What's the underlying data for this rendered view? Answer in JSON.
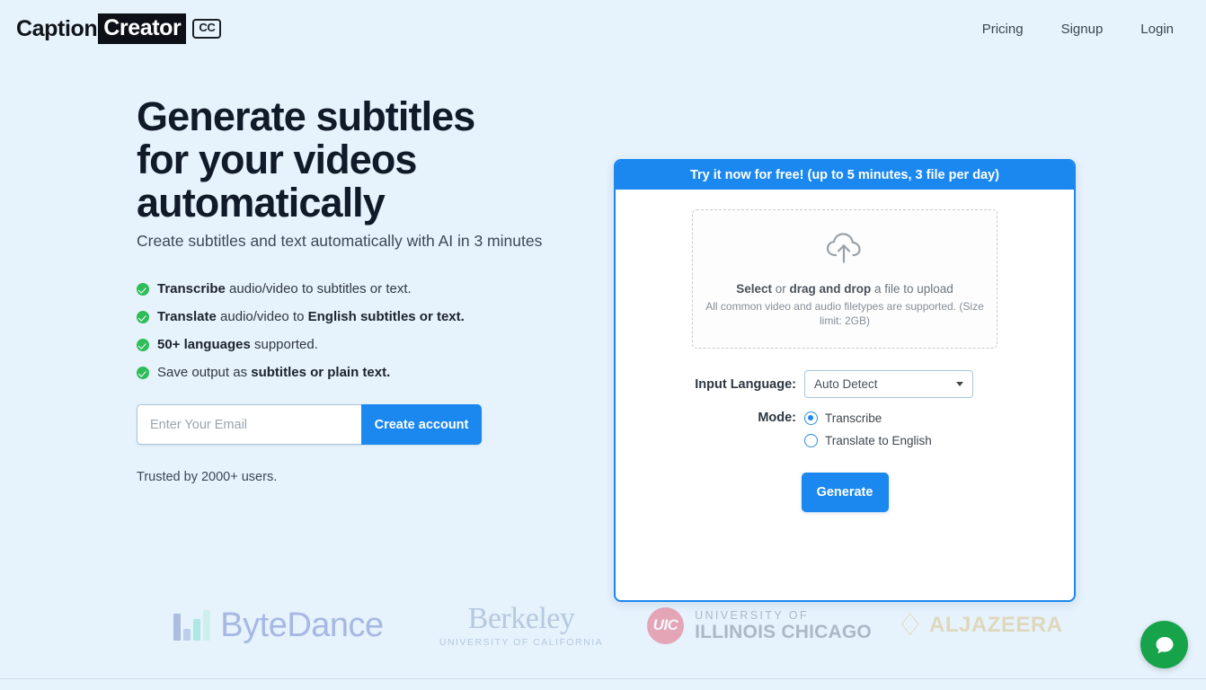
{
  "header": {
    "logo": {
      "part1": "Caption",
      "part2": "Creator",
      "badge": "CC"
    },
    "nav": [
      {
        "label": "Pricing"
      },
      {
        "label": "Signup"
      },
      {
        "label": "Login"
      }
    ]
  },
  "hero": {
    "headline": "Generate subtitles for your videos automatically",
    "subheadline": "Create subtitles and text automatically with AI in 3 minutes",
    "features": [
      {
        "bold_lead": "Transcribe",
        "text_mid": " audio/video to subtitles or text.",
        "bold_tail": ""
      },
      {
        "bold_lead": "Translate",
        "text_mid": " audio/video to ",
        "bold_tail": "English subtitles or text."
      },
      {
        "bold_lead": "50+ languages",
        "text_mid": " supported.",
        "bold_tail": ""
      },
      {
        "bold_lead": "",
        "text_mid": "Save output as ",
        "bold_tail": "subtitles or plain text."
      }
    ],
    "email_placeholder": "Enter Your Email",
    "email_value": "",
    "create_account_label": "Create account",
    "trusted_text": "Trusted by 2000+ users."
  },
  "card": {
    "banner": "Try it now for free! (up to 5 minutes, 3 file per day)",
    "dropzone": {
      "icon": "cloud-upload-icon",
      "line1_bold1": "Select",
      "line1_mid": " or ",
      "line1_bold2": "drag and drop",
      "line1_tail": " a file to upload",
      "line2": "All common video and audio filetypes are supported. (Size limit: 2GB)"
    },
    "language_label": "Input Language:",
    "language_value": "Auto Detect",
    "language_options": [
      "Auto Detect"
    ],
    "mode_label": "Mode:",
    "modes": [
      {
        "label": "Transcribe",
        "selected": true
      },
      {
        "label": "Translate to English",
        "selected": false
      }
    ],
    "generate_label": "Generate"
  },
  "logos": [
    {
      "name": "ByteDance",
      "text": "ByteDance"
    },
    {
      "name": "Berkeley",
      "text": "Berkeley",
      "sub": "UNIVERSITY OF CALIFORNIA"
    },
    {
      "name": "UIC",
      "badge": "UIC",
      "line1": "UNIVERSITY OF",
      "line2": "ILLINOIS CHICAGO"
    },
    {
      "name": "AlJazeera",
      "text": "ALJAZEERA"
    }
  ],
  "chat": {
    "icon": "chat-bubble-icon"
  },
  "colors": {
    "accent_blue": "#1b88f0",
    "page_bg": "#e6f2fc",
    "check_green": "#2ebd59",
    "chat_green": "#16a34a",
    "uic_pink": "#e3697f",
    "bytedance_purple": "#7289cf",
    "aljazeera_gold": "#d8c48a"
  }
}
